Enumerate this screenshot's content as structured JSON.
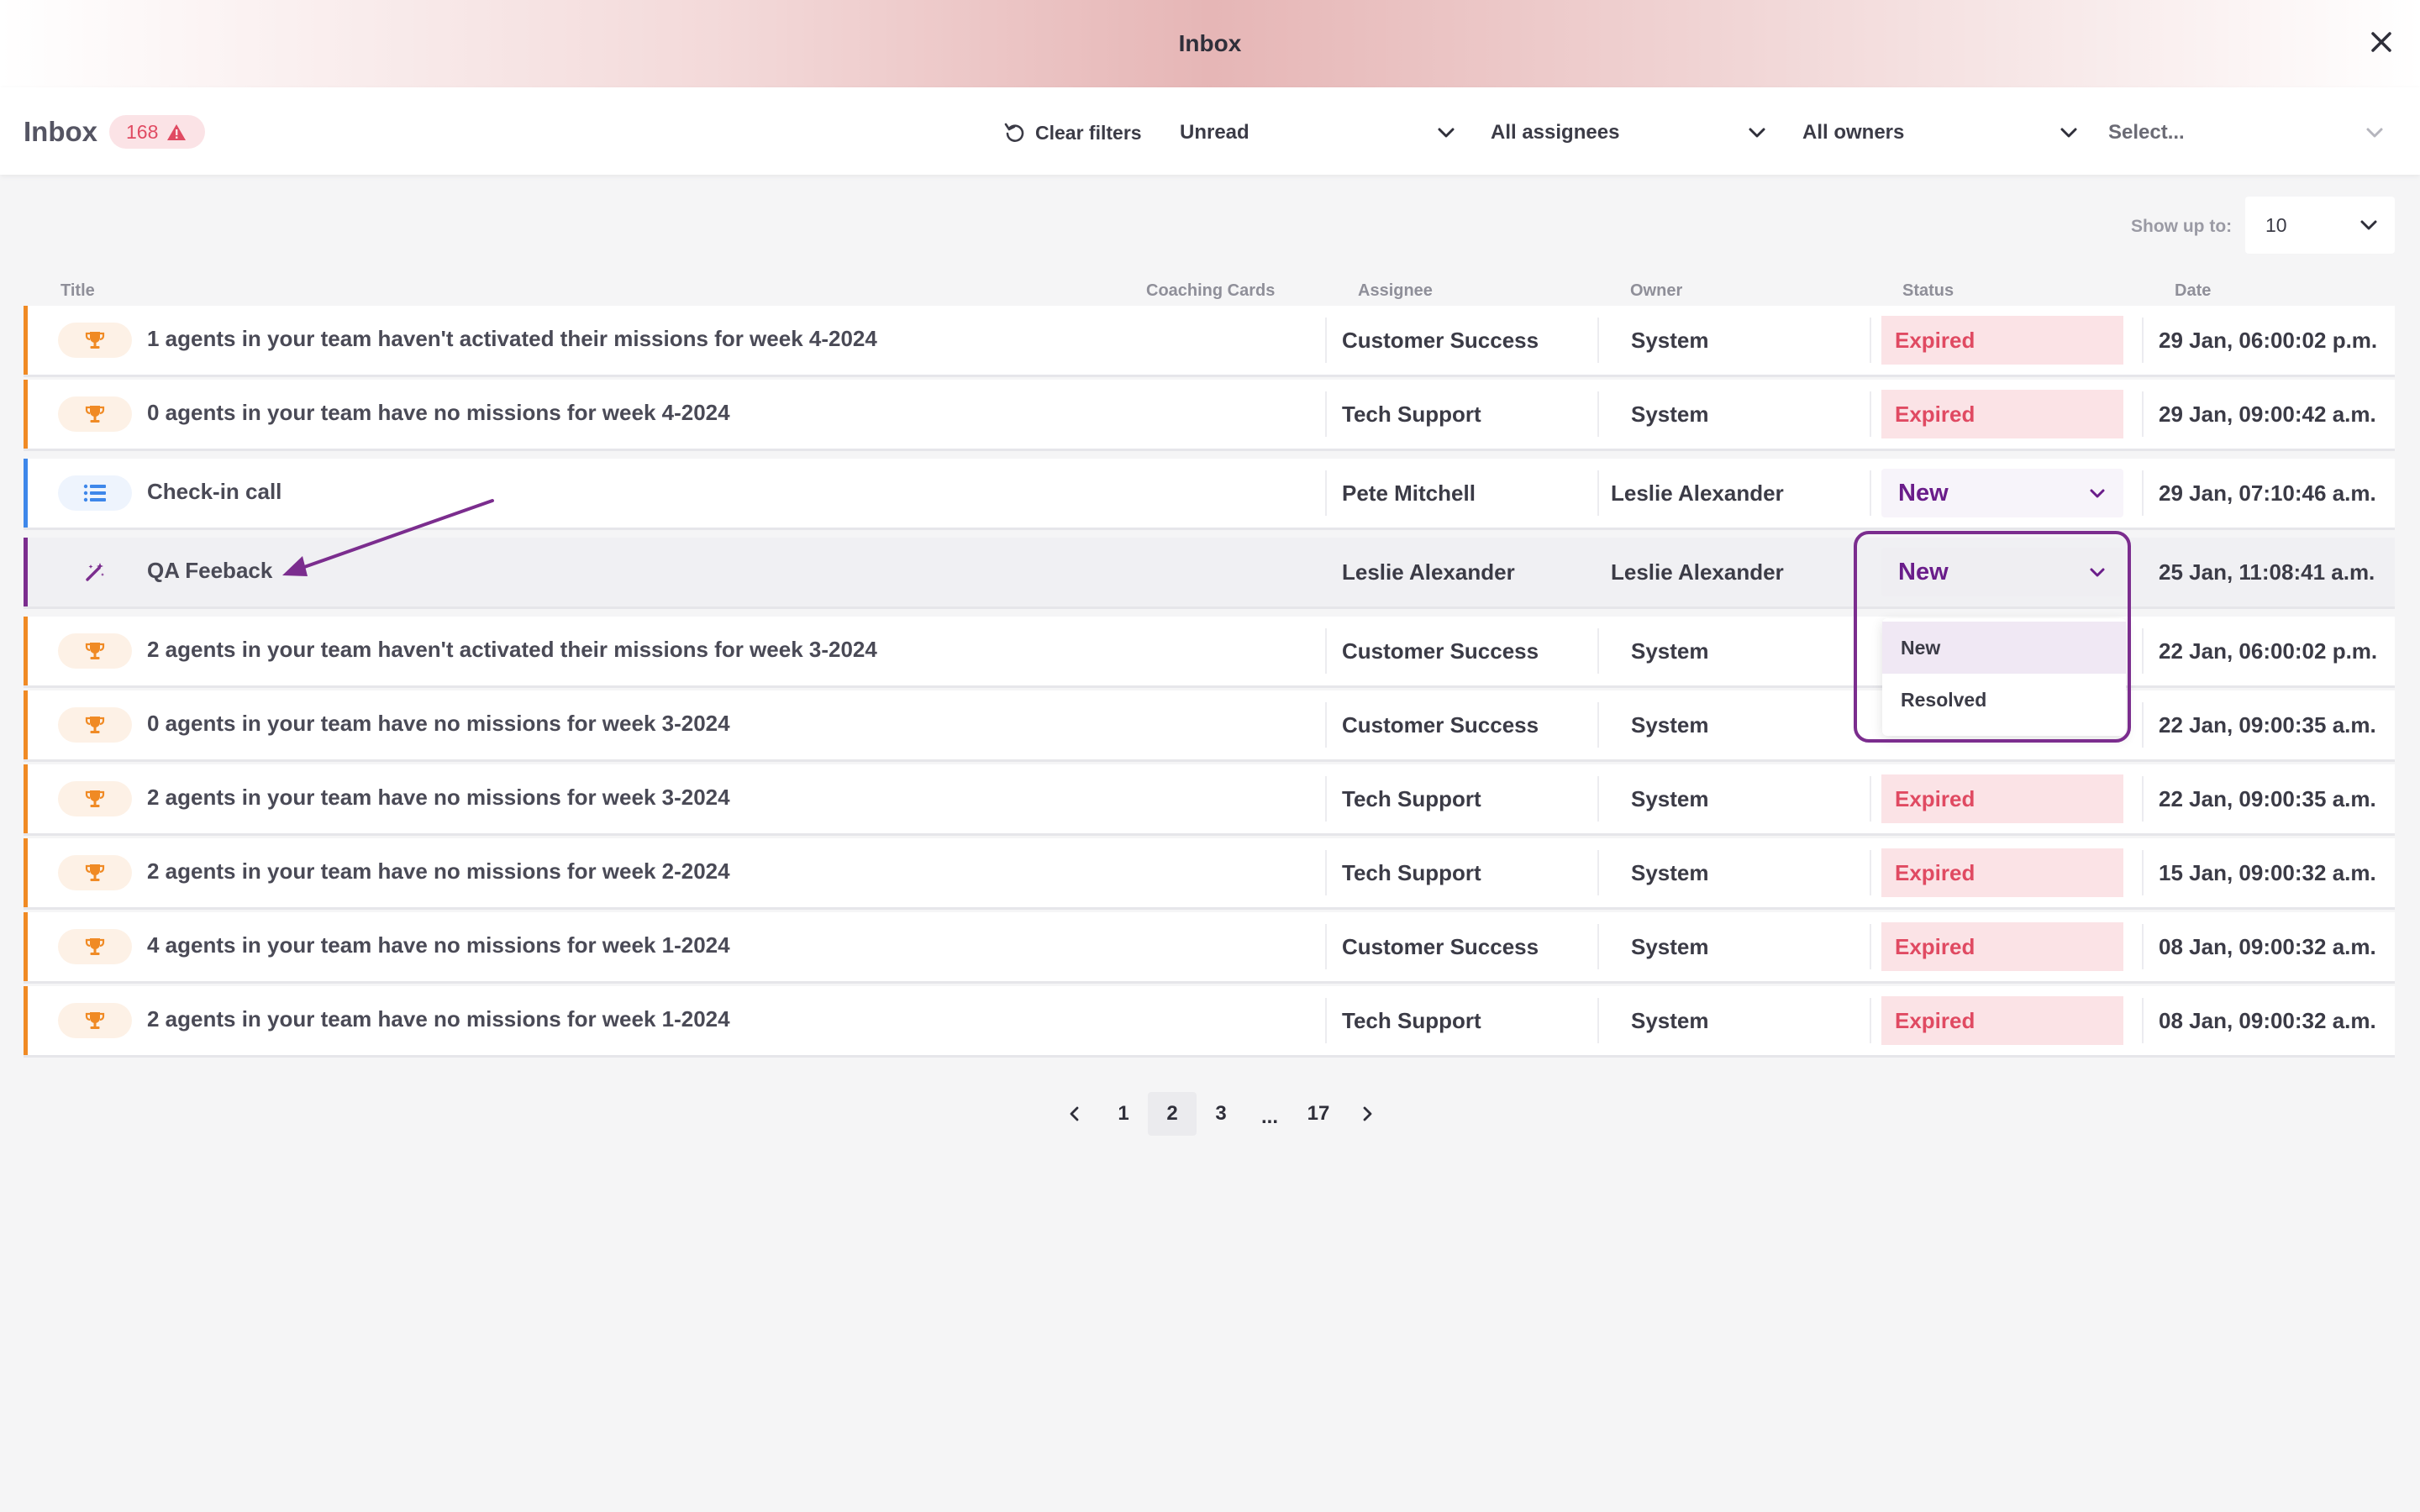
{
  "window": {
    "title": "Inbox"
  },
  "header": {
    "title": "Inbox",
    "count": "168",
    "clear_filters": "Clear filters",
    "filters": [
      "Unread",
      "All assignees",
      "All owners",
      "Select..."
    ]
  },
  "page_size": {
    "label": "Show up to:",
    "value": "10"
  },
  "columns": {
    "title": "Title",
    "coaching_cards": "Coaching Cards",
    "assignee": "Assignee",
    "owner": "Owner",
    "status": "Status",
    "date": "Date"
  },
  "rows": [
    {
      "icon": "trophy-icon",
      "title": "1 agents in your team haven't activated their missions for week 4-2024",
      "assignee": "Customer Success",
      "owner": "System",
      "status": "Expired",
      "date": "29 Jan, 06:00:02 p.m."
    },
    {
      "icon": "trophy-icon",
      "title": "0 agents in your team have no missions for week 4-2024",
      "assignee": "Tech Support",
      "owner": "System",
      "status": "Expired",
      "date": "29 Jan, 09:00:42 a.m."
    },
    {
      "icon": "list-icon",
      "title": "Check-in call",
      "assignee": "Pete Mitchell",
      "owner": "Leslie Alexander",
      "status": "New",
      "date": "29 Jan, 07:10:46 a.m."
    },
    {
      "icon": "magic-wand-icon",
      "title": "QA Feeback",
      "assignee": "Leslie Alexander",
      "owner": "Leslie Alexander",
      "status": "New",
      "date": "25 Jan, 11:08:41 a.m."
    },
    {
      "icon": "trophy-icon",
      "title": "2 agents in your team haven't activated their missions for week 3-2024",
      "assignee": "Customer Success",
      "owner": "System",
      "status": "",
      "date": "22 Jan, 06:00:02 p.m."
    },
    {
      "icon": "trophy-icon",
      "title": "0 agents in your team have no missions for week 3-2024",
      "assignee": "Customer Success",
      "owner": "System",
      "status": "",
      "date": "22 Jan, 09:00:35 a.m."
    },
    {
      "icon": "trophy-icon",
      "title": "2 agents in your team have no missions for week 3-2024",
      "assignee": "Tech Support",
      "owner": "System",
      "status": "Expired",
      "date": "22 Jan, 09:00:35 a.m."
    },
    {
      "icon": "trophy-icon",
      "title": "2 agents in your team have no missions for week 2-2024",
      "assignee": "Tech Support",
      "owner": "System",
      "status": "Expired",
      "date": "15 Jan, 09:00:32 a.m."
    },
    {
      "icon": "trophy-icon",
      "title": "4 agents in your team have no missions for week 1-2024",
      "assignee": "Customer Success",
      "owner": "System",
      "status": "Expired",
      "date": "08 Jan, 09:00:32 a.m."
    },
    {
      "icon": "trophy-icon",
      "title": "2 agents in your team have no missions for week 1-2024",
      "assignee": "Tech Support",
      "owner": "System",
      "status": "Expired",
      "date": "08 Jan, 09:00:32 a.m."
    }
  ],
  "status_dropdown": {
    "options": [
      "New",
      "Resolved"
    ],
    "selected": "New"
  },
  "pagination": {
    "pages": [
      "1",
      "2",
      "3",
      "...",
      "17"
    ],
    "current": "2"
  },
  "colors": {
    "accent_purple": "#7b2d8e",
    "expired_text": "#e04a62",
    "expired_bg": "#fbe3e6",
    "trophy_orange": "#f08a24",
    "blue": "#3e87ea"
  }
}
